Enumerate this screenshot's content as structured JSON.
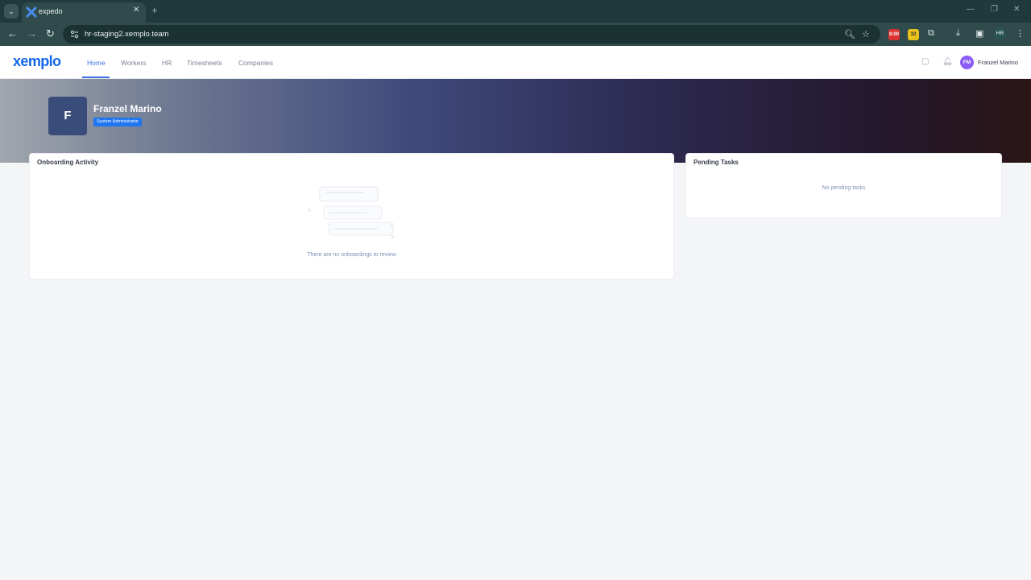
{
  "browser": {
    "tab_title": "expedo",
    "url": "hr-staging2.xemplo.team",
    "profile_initials": "HR",
    "ext_badge_1": "8:00",
    "ext_badge_2": "32"
  },
  "app": {
    "logo": "xemplo",
    "nav": [
      {
        "label": "Home",
        "active": true
      },
      {
        "label": "Workers"
      },
      {
        "label": "HR"
      },
      {
        "label": "Timesheets"
      },
      {
        "label": "Companies"
      }
    ],
    "user": {
      "initials": "FM",
      "name": "Franzel Marino"
    }
  },
  "profile": {
    "initial": "F",
    "name": "Franzel Marino",
    "role": "System Administrator"
  },
  "onboarding": {
    "title": "Onboarding Activity",
    "empty_text": "There are no onboardings to review"
  },
  "tasks": {
    "title": "Pending Tasks",
    "empty_text": "No pending tasks"
  },
  "colors": {
    "brand": "#1466e8",
    "accent": "#3b6fe0",
    "badge": "#1f76f2",
    "avatar": "#8b5cf6"
  }
}
